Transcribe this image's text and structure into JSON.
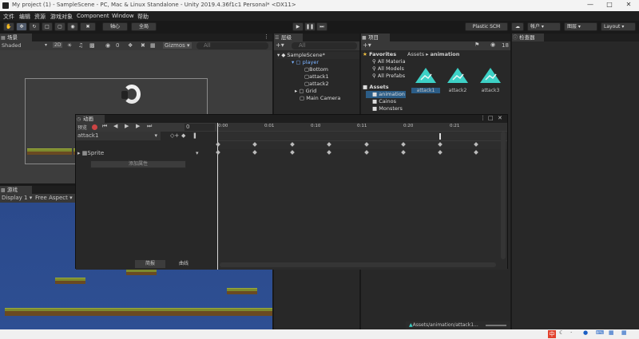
{
  "window": {
    "title": "My project (1) - SampleScene - PC, Mac & Linux Standalone - Unity 2019.4.36f1c1 Personal* <DX11>"
  },
  "menu": [
    "文件",
    "编辑",
    "资源",
    "游戏对象",
    "Component",
    "Window",
    "帮助"
  ],
  "toolbar": {
    "pivot": "轴心",
    "global": "全局",
    "plastic": "Plastic SCM",
    "account": "帐户",
    "layers": "图层",
    "layout": "Layout"
  },
  "scene": {
    "tab": "场景",
    "shading": "Shaded",
    "mode2d": "2D",
    "gizmos": "Gizmos",
    "search_placeholder": "All",
    "effects_count": "0"
  },
  "game": {
    "tab": "游戏",
    "display": "Display 1",
    "aspect": "Free Aspect"
  },
  "hierarchy": {
    "tab": "层级",
    "search_placeholder": "All",
    "items": [
      "SampleScene*",
      "player",
      "Bottom",
      "attack1",
      "attack2",
      "Grid",
      "Main Camera"
    ]
  },
  "project": {
    "tab": "项目",
    "hidden_count": "18",
    "favorites": "Favorites",
    "fav_items": [
      "All Materia",
      "All Models",
      "All Prefabs"
    ],
    "assets": "Assets",
    "folders": [
      "animation",
      "Cainos",
      "Monsters"
    ],
    "breadcrumb": [
      "Assets",
      "animation"
    ],
    "tiles": [
      "attack1",
      "attack2",
      "attack3"
    ],
    "status_path": "Assets/animation/attack1..."
  },
  "inspector": {
    "tab": "检查器"
  },
  "animation": {
    "tab": "动画",
    "preview": "预览",
    "frame": "0",
    "clip": "attack1",
    "property": "Sprite",
    "add_property": "添加属性",
    "tab_dopesheet": "简报",
    "tab_curves": "曲线",
    "ruler": [
      "0:00",
      "0:01",
      "0:10",
      "0:11",
      "0:20",
      "0:21"
    ]
  },
  "taskbar": {
    "ime": "中"
  }
}
